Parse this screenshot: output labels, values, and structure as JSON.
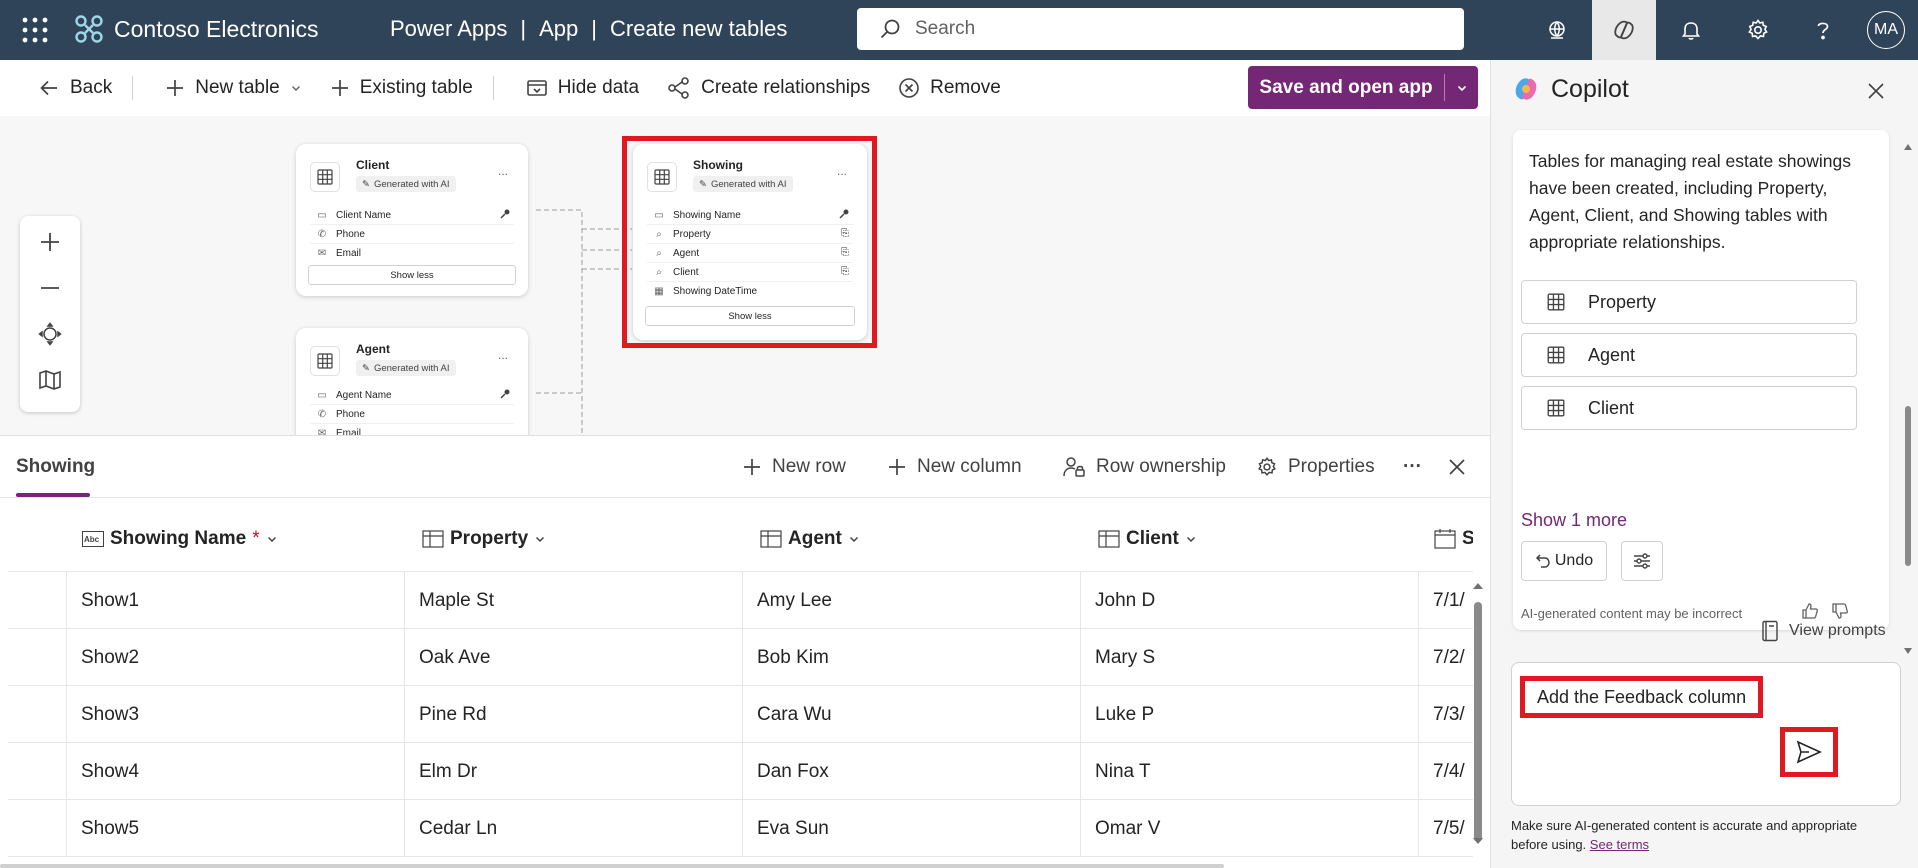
{
  "topbar": {
    "brand": "Contoso Electronics",
    "crumbs": [
      "Power Apps",
      "App",
      "Create new tables"
    ],
    "crumb_sep": "|",
    "search_placeholder": "Search",
    "avatar_initials": "MA"
  },
  "commands": {
    "back": "Back",
    "new_table": "New table",
    "existing_table": "Existing table",
    "hide_data": "Hide data",
    "create_relationships": "Create relationships",
    "remove": "Remove",
    "save_open": "Save and open app"
  },
  "canvas": {
    "generated_tag": "Generated with AI",
    "more": "...",
    "show_less": "Show less",
    "client_card": {
      "name": "Client",
      "fields": [
        "Client Name",
        "Phone",
        "Email"
      ]
    },
    "agent_card": {
      "name": "Agent",
      "fields": [
        "Agent Name",
        "Phone",
        "Email"
      ]
    },
    "showing_card": {
      "name": "Showing",
      "fields": [
        "Showing Name",
        "Property",
        "Agent",
        "Client",
        "Showing DateTime"
      ]
    }
  },
  "table_panel": {
    "title": "Showing",
    "new_row": "New row",
    "new_column": "New column",
    "row_ownership": "Row ownership",
    "properties": "Properties",
    "more": "···",
    "columns": [
      "Showing Name",
      "Property",
      "Agent",
      "Client",
      "Sho"
    ],
    "required_mark": "*",
    "rows": [
      [
        "Show1",
        "Maple St",
        "Amy Lee",
        "John D",
        "7/1/"
      ],
      [
        "Show2",
        "Oak Ave",
        "Bob Kim",
        "Mary S",
        "7/2/"
      ],
      [
        "Show3",
        "Pine Rd",
        "Cara Wu",
        "Luke P",
        "7/3/"
      ],
      [
        "Show4",
        "Elm Dr",
        "Dan Fox",
        "Nina T",
        "7/4/"
      ],
      [
        "Show5",
        "Cedar Ln",
        "Eva Sun",
        "Omar V",
        "7/5/"
      ]
    ]
  },
  "copilot": {
    "title": "Copilot",
    "message": "Tables for managing real estate showings have been created, including Property, Agent, Client, and Showing tables with appropriate relationships.",
    "table_refs": [
      "Property",
      "Agent",
      "Client"
    ],
    "show_more": "Show 1 more",
    "undo": "Undo",
    "disclaimer": "AI-generated content may be incorrect",
    "view_prompts": "View prompts",
    "input_value": "Add the Feedback column",
    "footnote": "Make sure AI-generated content is accurate and appropriate before using.",
    "see_terms": "See terms"
  },
  "colors": {
    "header_bg": "#2f4459",
    "accent": "#742774",
    "highlight": "#e0181f"
  }
}
